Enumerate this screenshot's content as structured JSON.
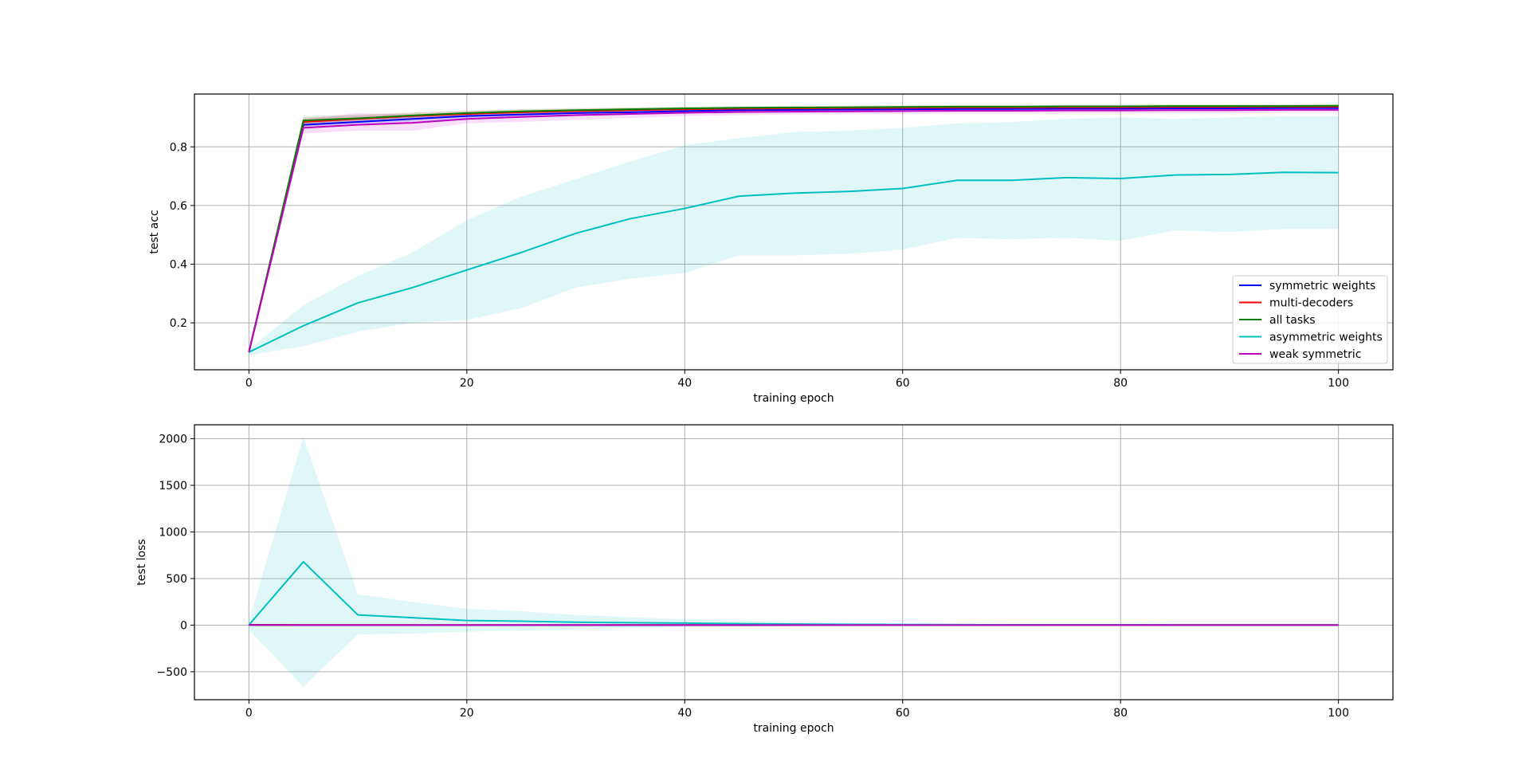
{
  "colors": {
    "symmetric": "#0000ff",
    "multi": "#ff0000",
    "all": "#008000",
    "asym": "#00bfbf",
    "weak": "#bf00bf",
    "grid": "#b0b0b0",
    "axes": "#000000"
  },
  "chart_data": [
    {
      "type": "line",
      "xlabel": "training epoch",
      "ylabel": "test acc",
      "xlim": [
        -5,
        105
      ],
      "ylim": [
        0.04,
        0.98
      ],
      "xticks": [
        0,
        20,
        40,
        60,
        80,
        100
      ],
      "yticks": [
        0.2,
        0.4,
        0.6,
        0.8
      ],
      "xtick_labels": [
        "0",
        "20",
        "40",
        "60",
        "80",
        "100"
      ],
      "ytick_labels": [
        "0.2",
        "0.4",
        "0.6",
        "0.8"
      ],
      "grid": true,
      "legend": "lower-right",
      "x": [
        0,
        5,
        10,
        15,
        20,
        25,
        30,
        35,
        40,
        45,
        50,
        55,
        60,
        65,
        70,
        75,
        80,
        85,
        90,
        95,
        100
      ],
      "series": [
        {
          "name": "symmetric weights",
          "color_key": "symmetric",
          "values": [
            0.1,
            0.875,
            0.885,
            0.895,
            0.905,
            0.91,
            0.915,
            0.918,
            0.922,
            0.925,
            0.926,
            0.927,
            0.928,
            0.929,
            0.929,
            0.93,
            0.93,
            0.931,
            0.931,
            0.932,
            0.932
          ],
          "lower": [
            0.1,
            0.865,
            0.876,
            0.886,
            0.897,
            0.903,
            0.908,
            0.911,
            0.915,
            0.918,
            0.919,
            0.92,
            0.921,
            0.922,
            0.922,
            0.923,
            0.923,
            0.924,
            0.924,
            0.925,
            0.925
          ],
          "upper": [
            0.1,
            0.885,
            0.894,
            0.904,
            0.913,
            0.917,
            0.922,
            0.925,
            0.929,
            0.932,
            0.933,
            0.934,
            0.935,
            0.936,
            0.936,
            0.937,
            0.937,
            0.938,
            0.938,
            0.939,
            0.939
          ]
        },
        {
          "name": "multi-decoders",
          "color_key": "multi",
          "values": [
            0.1,
            0.885,
            0.895,
            0.905,
            0.912,
            0.918,
            0.922,
            0.925,
            0.928,
            0.93,
            0.931,
            0.932,
            0.933,
            0.934,
            0.934,
            0.935,
            0.935,
            0.936,
            0.936,
            0.937,
            0.937
          ],
          "lower": [
            0.1,
            0.87,
            0.883,
            0.894,
            0.902,
            0.909,
            0.914,
            0.917,
            0.921,
            0.923,
            0.924,
            0.925,
            0.926,
            0.927,
            0.927,
            0.928,
            0.928,
            0.929,
            0.929,
            0.93,
            0.93
          ],
          "upper": [
            0.1,
            0.9,
            0.907,
            0.916,
            0.922,
            0.927,
            0.93,
            0.933,
            0.935,
            0.937,
            0.938,
            0.939,
            0.94,
            0.941,
            0.941,
            0.942,
            0.942,
            0.943,
            0.943,
            0.944,
            0.944
          ]
        },
        {
          "name": "all tasks",
          "color_key": "all",
          "values": [
            0.1,
            0.89,
            0.897,
            0.907,
            0.915,
            0.921,
            0.925,
            0.928,
            0.931,
            0.933,
            0.934,
            0.935,
            0.936,
            0.937,
            0.937,
            0.938,
            0.938,
            0.939,
            0.939,
            0.939,
            0.94
          ],
          "lower": [
            0.1,
            0.878,
            0.886,
            0.897,
            0.906,
            0.913,
            0.918,
            0.921,
            0.925,
            0.927,
            0.928,
            0.929,
            0.93,
            0.931,
            0.931,
            0.932,
            0.932,
            0.933,
            0.933,
            0.933,
            0.934
          ],
          "upper": [
            0.1,
            0.905,
            0.91,
            0.917,
            0.924,
            0.929,
            0.932,
            0.935,
            0.937,
            0.939,
            0.94,
            0.941,
            0.942,
            0.943,
            0.943,
            0.944,
            0.944,
            0.945,
            0.945,
            0.945,
            0.946
          ]
        },
        {
          "name": "asymmetric weights",
          "color_key": "asym",
          "values": [
            0.1,
            0.19,
            0.268,
            0.32,
            0.38,
            0.44,
            0.505,
            0.555,
            0.59,
            0.632,
            0.642,
            0.648,
            0.658,
            0.686,
            0.686,
            0.695,
            0.692,
            0.704,
            0.706,
            0.713,
            0.712
          ],
          "lower": [
            0.09,
            0.12,
            0.17,
            0.2,
            0.21,
            0.25,
            0.32,
            0.35,
            0.37,
            0.43,
            0.43,
            0.435,
            0.45,
            0.49,
            0.485,
            0.49,
            0.48,
            0.515,
            0.51,
            0.52,
            0.52
          ],
          "upper": [
            0.11,
            0.26,
            0.36,
            0.44,
            0.55,
            0.63,
            0.69,
            0.75,
            0.805,
            0.83,
            0.85,
            0.855,
            0.865,
            0.88,
            0.885,
            0.895,
            0.9,
            0.895,
            0.9,
            0.905,
            0.905
          ]
        },
        {
          "name": "weak symmetric",
          "color_key": "weak",
          "values": [
            0.1,
            0.865,
            0.875,
            0.882,
            0.895,
            0.902,
            0.908,
            0.912,
            0.916,
            0.919,
            0.92,
            0.921,
            0.922,
            0.923,
            0.923,
            0.924,
            0.924,
            0.925,
            0.925,
            0.926,
            0.926
          ],
          "lower": [
            0.1,
            0.845,
            0.855,
            0.855,
            0.88,
            0.885,
            0.892,
            0.898,
            0.905,
            0.908,
            0.91,
            0.911,
            0.912,
            0.913,
            0.913,
            0.914,
            0.914,
            0.915,
            0.915,
            0.916,
            0.916
          ],
          "upper": [
            0.1,
            0.895,
            0.915,
            0.91,
            0.915,
            0.918,
            0.922,
            0.925,
            0.927,
            0.929,
            0.93,
            0.931,
            0.932,
            0.933,
            0.933,
            0.934,
            0.934,
            0.935,
            0.935,
            0.936,
            0.936
          ]
        }
      ]
    },
    {
      "type": "line",
      "xlabel": "training epoch",
      "ylabel": "test loss",
      "xlim": [
        -5,
        105
      ],
      "ylim": [
        -800,
        2150
      ],
      "xticks": [
        0,
        20,
        40,
        60,
        80,
        100
      ],
      "yticks": [
        -500,
        0,
        500,
        1000,
        1500,
        2000
      ],
      "xtick_labels": [
        "0",
        "20",
        "40",
        "60",
        "80",
        "100"
      ],
      "ytick_labels": [
        "−500",
        "0",
        "500",
        "1000",
        "1500",
        "2000"
      ],
      "grid": true,
      "x": [
        0,
        5,
        10,
        15,
        20,
        25,
        30,
        35,
        40,
        45,
        50,
        55,
        60,
        65,
        70,
        75,
        80,
        85,
        90,
        95,
        100
      ],
      "series": [
        {
          "name": "symmetric weights",
          "color_key": "symmetric",
          "values": [
            2.3,
            0.4,
            0.4,
            0.4,
            0.4,
            0.4,
            0.4,
            0.4,
            0.4,
            0.4,
            0.4,
            0.4,
            0.4,
            0.4,
            0.4,
            0.4,
            0.4,
            0.4,
            0.4,
            0.4,
            0.4
          ]
        },
        {
          "name": "multi-decoders",
          "color_key": "multi",
          "values": [
            2.3,
            0.4,
            0.4,
            0.4,
            0.4,
            0.4,
            0.4,
            0.4,
            0.4,
            0.4,
            0.4,
            0.4,
            0.4,
            0.4,
            0.4,
            0.4,
            0.4,
            0.4,
            0.4,
            0.4,
            0.4
          ]
        },
        {
          "name": "all tasks",
          "color_key": "all",
          "values": [
            2.3,
            0.4,
            0.4,
            0.4,
            0.4,
            0.4,
            0.4,
            0.4,
            0.4,
            0.4,
            0.4,
            0.4,
            0.4,
            0.4,
            0.4,
            0.4,
            0.4,
            0.4,
            0.4,
            0.4,
            0.4
          ]
        },
        {
          "name": "asymmetric weights",
          "color_key": "asym",
          "values": [
            2.3,
            680,
            110,
            80,
            50,
            42,
            32,
            26,
            22,
            15,
            11,
            8,
            6,
            5,
            4,
            3,
            3,
            2,
            2,
            2,
            2
          ],
          "lower": [
            -50,
            -660,
            -100,
            -90,
            -70,
            -60,
            -45,
            -30,
            -20,
            -15,
            -10,
            -8,
            -6,
            -5,
            -4,
            -3,
            -3,
            -2,
            -2,
            -2,
            -2
          ],
          "upper": [
            50,
            2020,
            330,
            250,
            175,
            150,
            110,
            85,
            65,
            45,
            32,
            24,
            18,
            15,
            12,
            9,
            8,
            6,
            6,
            6,
            6
          ]
        },
        {
          "name": "weak symmetric",
          "color_key": "weak",
          "values": [
            2.3,
            0.5,
            0.5,
            0.5,
            0.5,
            0.5,
            0.5,
            0.5,
            0.5,
            0.5,
            0.5,
            0.5,
            0.5,
            0.5,
            0.5,
            0.5,
            0.5,
            0.5,
            0.5,
            0.5,
            0.5
          ]
        }
      ]
    }
  ]
}
